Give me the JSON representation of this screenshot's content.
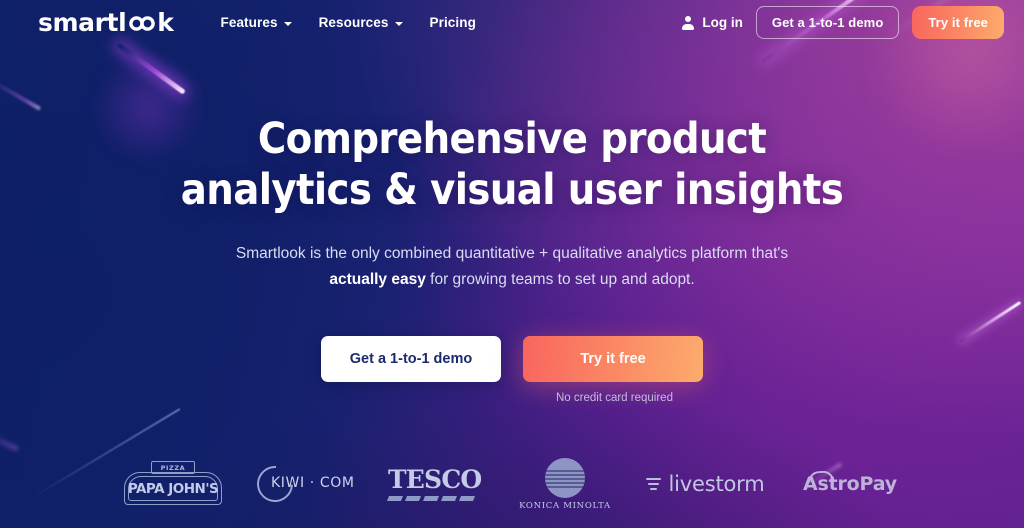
{
  "brand": {
    "logo_text_before": "smartl",
    "logo_infinity": "∞",
    "logo_text_after": "k",
    "logo_full": "smartlook"
  },
  "nav": {
    "links": [
      {
        "label": "Features",
        "has_caret": true
      },
      {
        "label": "Resources",
        "has_caret": true
      },
      {
        "label": "Pricing",
        "has_caret": false
      }
    ],
    "login_label": "Log in",
    "demo_button": "Get a 1-to-1 demo",
    "try_button": "Try it free"
  },
  "hero": {
    "headline_line1": "Comprehensive product",
    "headline_line2": "analytics & visual user insights",
    "sub_line1": "Smartlook is the only combined quantitative + qualitative analytics platform that's",
    "sub_bold": "actually easy",
    "sub_line2_rest": " for growing teams to set up and adopt.",
    "cta_demo": "Get a 1-to-1 demo",
    "cta_try": "Try it free",
    "no_credit_card": "No credit card required"
  },
  "logos": [
    {
      "name": "Papa John's",
      "banner": "PIZZA",
      "wordmark": "PAPA JOHN'S"
    },
    {
      "name": "Kiwi.com",
      "wordmark": "KIWI · COM"
    },
    {
      "name": "Tesco",
      "wordmark": "TESCO"
    },
    {
      "name": "Konica Minolta",
      "wordmark": "KONICA MINOLTA"
    },
    {
      "name": "Livestorm",
      "wordmark": "livestorm"
    },
    {
      "name": "AstroPay",
      "wordmark": "AstroPay"
    }
  ],
  "colors": {
    "bg_navy": "#122169",
    "bg_purple": "#6b2394",
    "cta_gradient_start": "#f9655f",
    "cta_gradient_end": "#fcab6d",
    "white_btn_text": "#1b2a6b",
    "sub_text": "#d9dcf2",
    "logo_strip": "#c2cbe8"
  }
}
